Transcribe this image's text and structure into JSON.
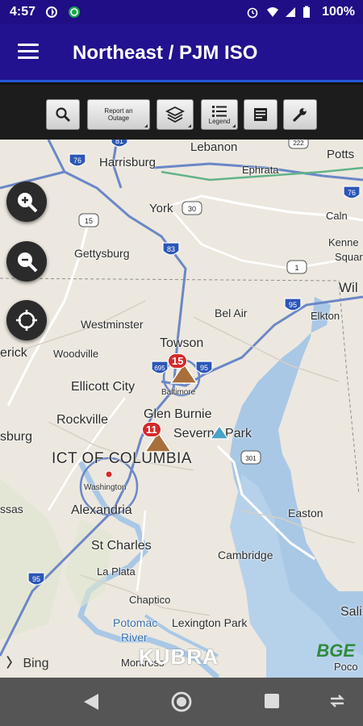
{
  "status_bar": {
    "time": "4:57",
    "battery": "100%"
  },
  "app_bar": {
    "title": "Northeast / PJM ISO"
  },
  "toolbar": {
    "report_outage_label": "Report an Outage",
    "legend_label": "Legend"
  },
  "map": {
    "places": {
      "lebanon": "Lebanon",
      "potts": "Potts",
      "harrisburg": "Harrisburg",
      "ephrata": "Ephrata",
      "york": "York",
      "calm": "Caln",
      "kenne": "Kenne",
      "squar": "Squar",
      "gettysburg": "Gettysburg",
      "wil": "Wil",
      "belair": "Bel Air",
      "elkton": "Elkton",
      "westminster": "Westminster",
      "towson": "Towson",
      "erick": "erick",
      "woodville": "Woodville",
      "ellicott": "Ellicott City",
      "baltimore": "Baltimore",
      "glenburnie": "Glen Burnie",
      "rockville": "Rockville",
      "sburg": "sburg",
      "severnapark": "Severna Park",
      "dc": "ICT OF COLUMBIA",
      "washington": "Washington",
      "ssas": "ssas",
      "alexandria": "Alexandria",
      "easton": "Easton",
      "stcharles": "St Charles",
      "cambridge": "Cambridge",
      "laplata": "La Plata",
      "chaptico": "Chaptico",
      "sali": "Sali",
      "potomac": "Potomac",
      "river": "River",
      "lexington": "Lexington Park",
      "montross": "Montross",
      "poco": "Poco"
    },
    "routes": {
      "i76": "76",
      "i81": "81",
      "i222": "222",
      "us15": "15",
      "us30": "30",
      "i83": "83",
      "i76e": "76",
      "i1": "1",
      "i95n": "95",
      "i695": "695",
      "i95b": "95",
      "us301": "301",
      "i95s": "95"
    },
    "outages": [
      {
        "count": "15",
        "area": "baltimore"
      },
      {
        "count": "11",
        "area": "dc"
      }
    ],
    "attribution": {
      "bing": "Bing",
      "kubra": "KUBRA",
      "bge": "BGE"
    }
  }
}
